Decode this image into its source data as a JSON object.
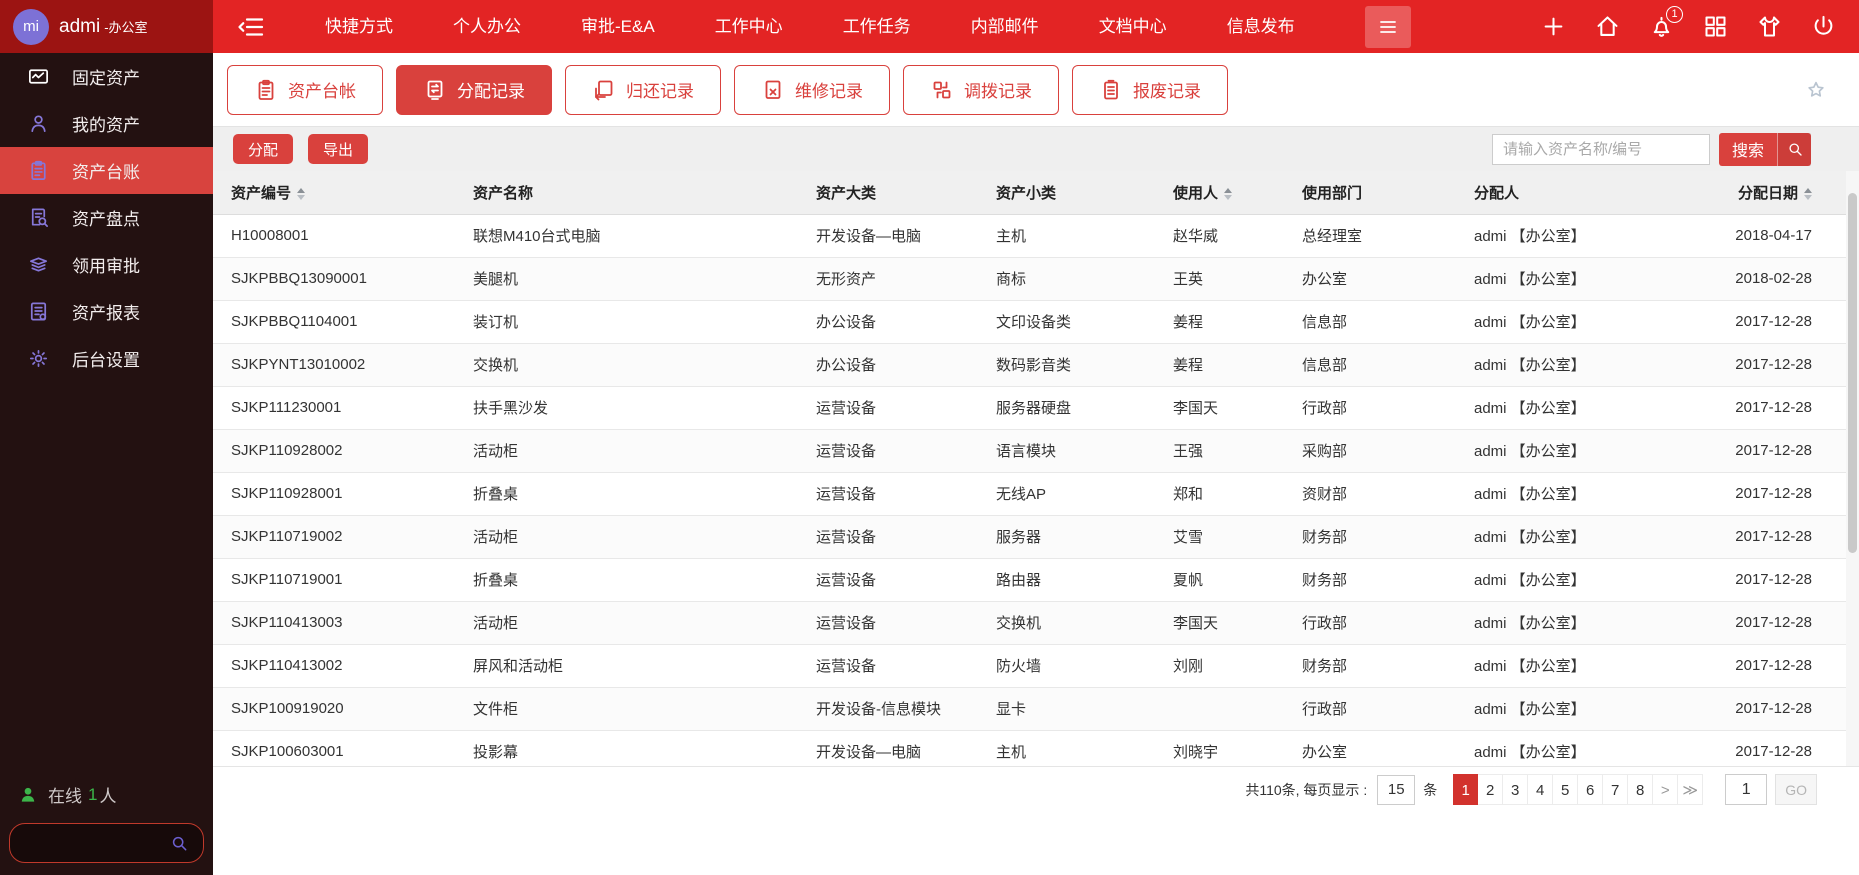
{
  "colors": {
    "nav_bg": "#e32424",
    "brand_bg": "#9c1412",
    "avatar_bg": "#7d71d6",
    "side_bg": "#231111",
    "side_active": "#d8433e",
    "side_icon": "#8677d8",
    "accent": "#d9413d",
    "pag_active": "#d2322d",
    "green": "#3cb54a"
  },
  "topbar": {
    "avatar_text": "mi",
    "user_name": "admi",
    "user_dept": "-办公室",
    "nav_items": [
      "快捷方式",
      "个人办公",
      "审批-E&A",
      "工作中心",
      "工作任务",
      "内部邮件",
      "文档中心",
      "信息发布"
    ],
    "action_icons": [
      {
        "icon": "plus-icon"
      },
      {
        "icon": "home-icon"
      },
      {
        "icon": "bell-icon",
        "badge": "1"
      },
      {
        "icon": "apps-icon"
      },
      {
        "icon": "shirt-icon"
      },
      {
        "icon": "power-icon"
      }
    ]
  },
  "sidebar": {
    "items": [
      {
        "label": "固定资产",
        "icon": "mail-chart-icon",
        "active": false
      },
      {
        "label": "我的资产",
        "icon": "user-icon",
        "active": false
      },
      {
        "label": "资产台账",
        "icon": "clipboard-icon",
        "active": true
      },
      {
        "label": "资产盘点",
        "icon": "doc-search-icon",
        "active": false
      },
      {
        "label": "领用审批",
        "icon": "layers-icon",
        "active": false
      },
      {
        "label": "资产报表",
        "icon": "report-icon",
        "active": false
      },
      {
        "label": "后台设置",
        "icon": "gear-icon",
        "active": false
      }
    ],
    "online_label": "在线",
    "online_count": "1",
    "online_suffix": "人"
  },
  "tabs": [
    {
      "label": "资产台帐",
      "icon": "ledger-icon",
      "active": false
    },
    {
      "label": "分配记录",
      "icon": "assign-icon",
      "active": true
    },
    {
      "label": "归还记录",
      "icon": "return-icon",
      "active": false
    },
    {
      "label": "维修记录",
      "icon": "repair-icon",
      "active": false
    },
    {
      "label": "调拨记录",
      "icon": "transfer-icon",
      "active": false
    },
    {
      "label": "报废记录",
      "icon": "scrap-icon",
      "active": false
    }
  ],
  "toolbar": {
    "assign_label": "分配",
    "export_label": "导出",
    "search_placeholder": "请输入资产名称/编号",
    "search_label": "搜索"
  },
  "table": {
    "columns": [
      {
        "label": "资产编号",
        "sortable": true
      },
      {
        "label": "资产名称",
        "sortable": false
      },
      {
        "label": "资产大类",
        "sortable": false
      },
      {
        "label": "资产小类",
        "sortable": false
      },
      {
        "label": "使用人",
        "sortable": true
      },
      {
        "label": "使用部门",
        "sortable": false
      },
      {
        "label": "分配人",
        "sortable": false
      },
      {
        "label": "分配日期",
        "sortable": true
      }
    ],
    "rows": [
      [
        "H10008001",
        "联想M410台式电脑",
        "开发设备—电脑",
        "主机",
        "赵华威",
        "总经理室",
        "admi 【办公室】",
        "2018-04-17"
      ],
      [
        "SJKPBBQ13090001",
        "美腿机",
        "无形资产",
        "商标",
        "王英",
        "办公室",
        "admi 【办公室】",
        "2018-02-28"
      ],
      [
        "SJKPBBQ1104001",
        "装订机",
        "办公设备",
        "文印设备类",
        "姜程",
        "信息部",
        "admi 【办公室】",
        "2017-12-28"
      ],
      [
        "SJKPYNT13010002",
        "交换机",
        "办公设备",
        "数码影音类",
        "姜程",
        "信息部",
        "admi 【办公室】",
        "2017-12-28"
      ],
      [
        "SJKP111230001",
        "扶手黑沙发",
        "运营设备",
        "服务器硬盘",
        "李国天",
        "行政部",
        "admi 【办公室】",
        "2017-12-28"
      ],
      [
        "SJKP110928002",
        "活动柜",
        "运营设备",
        "语言模块",
        "王强",
        "采购部",
        "admi 【办公室】",
        "2017-12-28"
      ],
      [
        "SJKP110928001",
        "折叠桌",
        "运营设备",
        "无线AP",
        "郑和",
        "资财部",
        "admi 【办公室】",
        "2017-12-28"
      ],
      [
        "SJKP110719002",
        "活动柜",
        "运营设备",
        "服务器",
        "艾雪",
        "财务部",
        "admi 【办公室】",
        "2017-12-28"
      ],
      [
        "SJKP110719001",
        "折叠桌",
        "运营设备",
        "路由器",
        "夏帆",
        "财务部",
        "admi 【办公室】",
        "2017-12-28"
      ],
      [
        "SJKP110413003",
        "活动柜",
        "运营设备",
        "交换机",
        "李国天",
        "行政部",
        "admi 【办公室】",
        "2017-12-28"
      ],
      [
        "SJKP110413002",
        "屏风和活动柜",
        "运营设备",
        "防火墙",
        "刘刚",
        "财务部",
        "admi 【办公室】",
        "2017-12-28"
      ],
      [
        "SJKP100919020",
        "文件柜",
        "开发设备-信息模块",
        "显卡",
        "",
        "行政部",
        "admi 【办公室】",
        "2017-12-28"
      ],
      [
        "SJKP100603001",
        "投影幕",
        "开发设备—电脑",
        "主机",
        "刘晓宇",
        "办公室",
        "admi 【办公室】",
        "2017-12-28"
      ]
    ]
  },
  "pagination": {
    "total_text": "共110条, 每页显示 :",
    "page_size": "15",
    "unit": "条",
    "pages": [
      "1",
      "2",
      "3",
      "4",
      "5",
      "6",
      "7",
      "8"
    ],
    "active_page": "1",
    "next_label": ">",
    "last_label": "≫",
    "goto_value": "1",
    "go_label": "GO"
  }
}
